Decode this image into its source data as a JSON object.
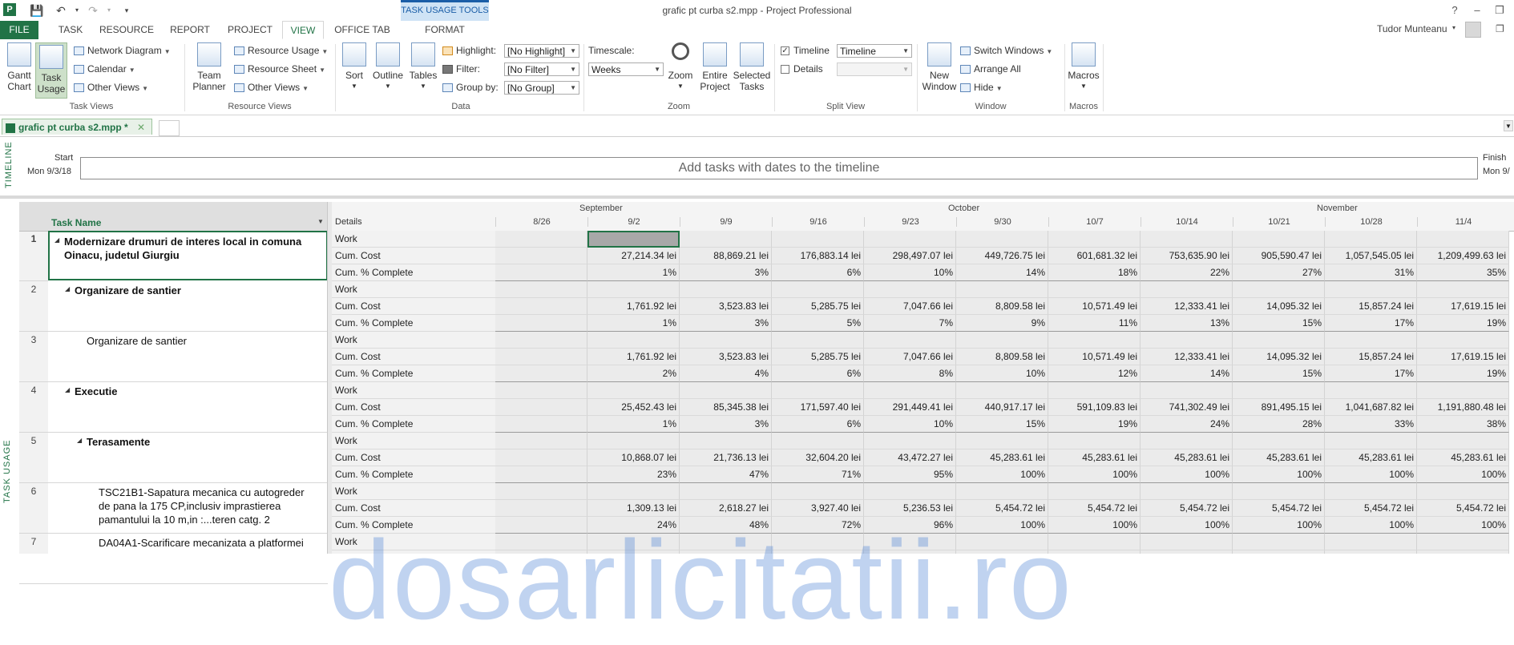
{
  "window": {
    "title": "grafic pt curba s2.mpp - Project Professional",
    "context_title": "TASK USAGE TOOLS",
    "user": "Tudor Munteanu",
    "help": "?",
    "minimize": "–",
    "restore": "❐",
    "close": "✕"
  },
  "quick_access": {
    "app": "P",
    "save": "💾",
    "undo": "↶",
    "redo": "↷"
  },
  "tabs": [
    "FILE",
    "TASK",
    "RESOURCE",
    "REPORT",
    "PROJECT",
    "VIEW",
    "OFFICE TAB",
    "FORMAT"
  ],
  "ribbon": {
    "task_views": {
      "label": "Task Views",
      "gantt": "Gantt Chart",
      "task_usage": "Task Usage",
      "network": "Network Diagram",
      "calendar": "Calendar",
      "other": "Other Views"
    },
    "resource_views": {
      "label": "Resource Views",
      "team_planner": "Team Planner",
      "usage": "Resource Usage",
      "sheet": "Resource Sheet",
      "other": "Other Views"
    },
    "data": {
      "label": "Data",
      "sort": "Sort",
      "outline": "Outline",
      "tables": "Tables",
      "highlight_label": "Highlight:",
      "highlight_value": "[No Highlight]",
      "filter_label": "Filter:",
      "filter_value": "[No Filter]",
      "group_label": "Group by:",
      "group_value": "[No Group]"
    },
    "zoom": {
      "label": "Zoom",
      "timescale_label": "Timescale:",
      "timescale_value": "Weeks",
      "zoom": "Zoom",
      "entire": "Entire Project",
      "selected": "Selected Tasks"
    },
    "split": {
      "label": "Split View",
      "timeline": "Timeline",
      "timeline_checked": true,
      "timeline_value": "Timeline",
      "details": "Details",
      "details_checked": false
    },
    "window": {
      "label": "Window",
      "new_window": "New Window",
      "switch": "Switch Windows",
      "arrange": "Arrange All",
      "hide": "Hide"
    },
    "macros": {
      "label": "Macros",
      "macros": "Macros"
    }
  },
  "doc_tab": {
    "name": "grafic pt curba s2.mpp *",
    "close": "✕"
  },
  "timeline": {
    "vertical_label": "TIMELINE",
    "start_label": "Start",
    "start_date": "Mon 9/3/18",
    "finish_label": "Finish",
    "finish_date": "Mon 9/",
    "placeholder": "Add tasks with dates to the timeline"
  },
  "view_label": "TASK USAGE",
  "grid": {
    "task_name_header": "Task Name",
    "details_header": "Details",
    "months": [
      "September",
      "October",
      "November"
    ],
    "weeks": [
      "8/26",
      "9/2",
      "9/9",
      "9/16",
      "9/23",
      "9/30",
      "10/7",
      "10/14",
      "10/21",
      "10/28",
      "11/4"
    ],
    "tasks": [
      {
        "id": "1",
        "name": "Modernizare drumuri de interes local in comuna Oinacu, judetul Giurgiu",
        "level": 0,
        "bold": true,
        "summary": true,
        "cost": [
          "",
          "27,214.34 lei",
          "88,869.21 lei",
          "176,883.14 lei",
          "298,497.07 lei",
          "449,726.75 lei",
          "601,681.32 lei",
          "753,635.90 lei",
          "905,590.47 lei",
          "1,057,545.05 lei",
          "1,209,499.63 lei"
        ],
        "pct": [
          "",
          "1%",
          "3%",
          "6%",
          "10%",
          "14%",
          "18%",
          "22%",
          "27%",
          "31%",
          "35%"
        ]
      },
      {
        "id": "2",
        "name": "Organizare de santier",
        "level": 1,
        "bold": true,
        "summary": true,
        "cost": [
          "",
          "1,761.92 lei",
          "3,523.83 lei",
          "5,285.75 lei",
          "7,047.66 lei",
          "8,809.58 lei",
          "10,571.49 lei",
          "12,333.41 lei",
          "14,095.32 lei",
          "15,857.24 lei",
          "17,619.15 lei"
        ],
        "pct": [
          "",
          "1%",
          "3%",
          "5%",
          "7%",
          "9%",
          "11%",
          "13%",
          "15%",
          "17%",
          "19%"
        ]
      },
      {
        "id": "3",
        "name": "Organizare de santier",
        "level": 2,
        "bold": false,
        "summary": false,
        "cost": [
          "",
          "1,761.92 lei",
          "3,523.83 lei",
          "5,285.75 lei",
          "7,047.66 lei",
          "8,809.58 lei",
          "10,571.49 lei",
          "12,333.41 lei",
          "14,095.32 lei",
          "15,857.24 lei",
          "17,619.15 lei"
        ],
        "pct": [
          "",
          "2%",
          "4%",
          "6%",
          "8%",
          "10%",
          "12%",
          "14%",
          "15%",
          "17%",
          "19%"
        ]
      },
      {
        "id": "4",
        "name": "Executie",
        "level": 1,
        "bold": true,
        "summary": true,
        "cost": [
          "",
          "25,452.43 lei",
          "85,345.38 lei",
          "171,597.40 lei",
          "291,449.41 lei",
          "440,917.17 lei",
          "591,109.83 lei",
          "741,302.49 lei",
          "891,495.15 lei",
          "1,041,687.82 lei",
          "1,191,880.48 lei"
        ],
        "pct": [
          "",
          "1%",
          "3%",
          "6%",
          "10%",
          "15%",
          "19%",
          "24%",
          "28%",
          "33%",
          "38%"
        ]
      },
      {
        "id": "5",
        "name": "Terasamente",
        "level": 2,
        "bold": true,
        "summary": true,
        "cost": [
          "",
          "10,868.07 lei",
          "21,736.13 lei",
          "32,604.20 lei",
          "43,472.27 lei",
          "45,283.61 lei",
          "45,283.61 lei",
          "45,283.61 lei",
          "45,283.61 lei",
          "45,283.61 lei",
          "45,283.61 lei"
        ],
        "pct": [
          "",
          "23%",
          "47%",
          "71%",
          "95%",
          "100%",
          "100%",
          "100%",
          "100%",
          "100%",
          "100%"
        ]
      },
      {
        "id": "6",
        "name": "TSC21B1-Sapatura mecanica cu autogreder de pana la 175 CP,inclusiv imprastierea pamantului la 10 m,in :...teren catg. 2",
        "level": 3,
        "bold": false,
        "summary": false,
        "cost": [
          "",
          "1,309.13 lei",
          "2,618.27 lei",
          "3,927.40 lei",
          "5,236.53 lei",
          "5,454.72 lei",
          "5,454.72 lei",
          "5,454.72 lei",
          "5,454.72 lei",
          "5,454.72 lei",
          "5,454.72 lei"
        ],
        "pct": [
          "",
          "24%",
          "48%",
          "72%",
          "96%",
          "100%",
          "100%",
          "100%",
          "100%",
          "100%",
          "100%"
        ]
      },
      {
        "id": "7",
        "name": "DA04A1-Scarificare mecanizata a platformei",
        "level": 3,
        "bold": false,
        "summary": false,
        "cost": [],
        "pct": []
      }
    ],
    "detail_labels": [
      "Work",
      "Cum. Cost",
      "Cum. % Complete"
    ]
  },
  "watermark": "dosarlicitatii.ro"
}
